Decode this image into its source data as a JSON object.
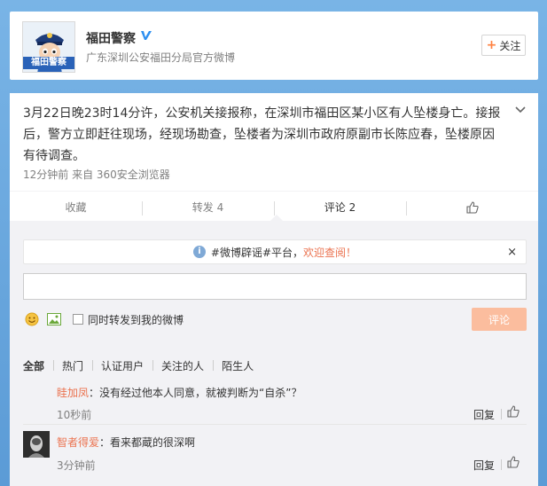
{
  "profile": {
    "name": "福田警察",
    "description": "广东深圳公安福田分局官方微博",
    "avatar_text": "福田警察",
    "follow_label": "关注"
  },
  "post": {
    "text": "3月22日晚23时14分许，公安机关接报称，在深圳市福田区某小区有人坠楼身亡。接报后，警方立即赶往现场，经现场勘查，坠楼者为深圳市政府原副市长陈应春，坠楼原因有待调查。",
    "meta": "12分钟前 来自 360安全浏览器"
  },
  "actions": {
    "favorite": "收藏",
    "repost": "转发 4",
    "comment": "评论 2"
  },
  "notice": {
    "prefix": "#微博辟谣#平台，",
    "link": "欢迎查阅！",
    "close": "×"
  },
  "composer": {
    "input_value": "",
    "repost_label": "同时转发到我的微博",
    "submit_label": "评论"
  },
  "filters": [
    "全部",
    "热门",
    "认证用户",
    "关注的人",
    "陌生人"
  ],
  "comments": [
    {
      "user": "眭加凤",
      "text": "：没有经过他本人同意，就被判断为“自杀”？",
      "time": "10秒前",
      "reply": "回复"
    },
    {
      "user": "智者得爱",
      "text": "：看来都蔵的很深啊",
      "time": "3分钟前",
      "reply": "回复"
    }
  ],
  "colors": {
    "accent": "#eb7350",
    "background": "#6fa8dc",
    "submit_disabled": "#fbbd9e"
  }
}
